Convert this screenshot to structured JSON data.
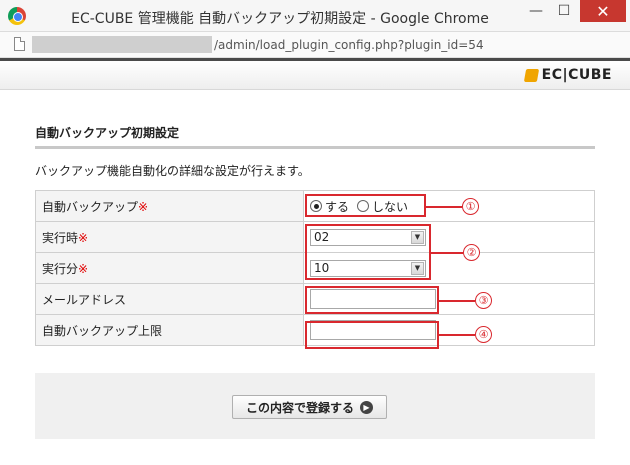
{
  "window": {
    "title": "EC-CUBE 管理機能 自動バックアップ初期設定 - Google Chrome",
    "minimize": "—",
    "maximize": "☐",
    "close": "✕"
  },
  "addressbar": {
    "url": "/admin/load_plugin_config.php?plugin_id=54"
  },
  "header": {
    "logo_text": "EC|CUBE"
  },
  "section": {
    "title": "自動バックアップ初期設定",
    "description": "バックアップ機能自動化の詳細な設定が行えます。"
  },
  "form": {
    "required_mark": "※",
    "rows": [
      {
        "label": "自動バックアップ",
        "required": true
      },
      {
        "label": "実行時",
        "required": true
      },
      {
        "label": "実行分",
        "required": true
      },
      {
        "label": "メールアドレス",
        "required": false
      },
      {
        "label": "自動バックアップ上限",
        "required": false
      }
    ],
    "auto_backup": {
      "options": [
        "する",
        "しない"
      ],
      "selected": "する"
    },
    "hour": {
      "value": "02"
    },
    "minute": {
      "value": "10"
    },
    "email": {
      "value": ""
    },
    "limit": {
      "value": ""
    }
  },
  "annotations": [
    "①",
    "②",
    "③",
    "④"
  ],
  "footer": {
    "submit_label": "この内容で登録する"
  },
  "colors": {
    "annotation": "#d9282e",
    "required": "#e00000",
    "close_button": "#c7372f"
  }
}
